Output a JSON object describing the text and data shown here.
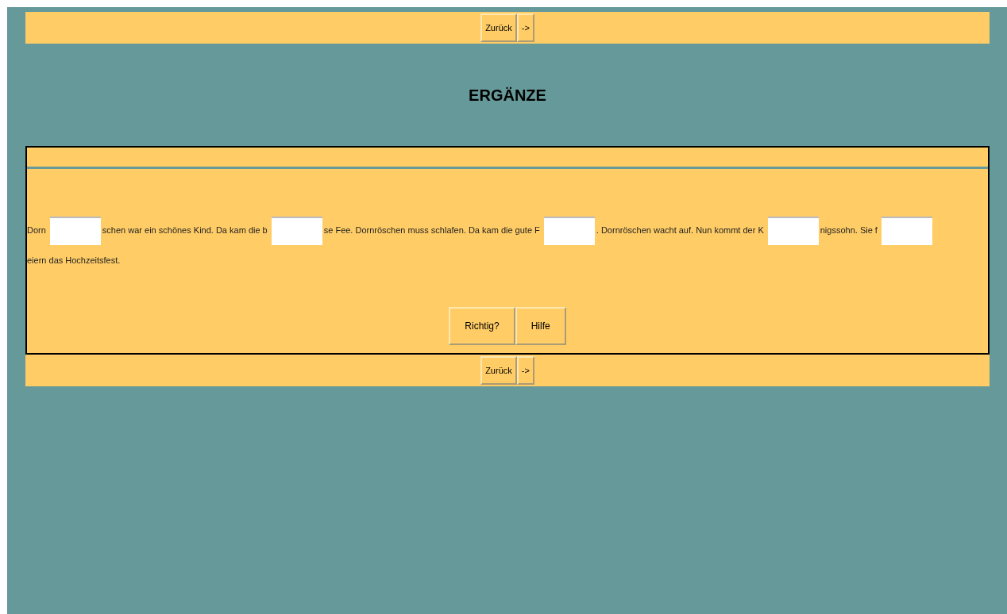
{
  "top_nav": {
    "buttons": [
      "Zurück",
      "->"
    ]
  },
  "title": "ERGÄNZE",
  "exercise": {
    "segments": [
      {
        "kind": "text",
        "text": "Dorn"
      },
      {
        "kind": "field"
      },
      {
        "kind": "text",
        "text": "schen war ein schönes Kind. Da kam die b"
      },
      {
        "kind": "field"
      },
      {
        "kind": "text",
        "text": "se Fee. Dornröschen muss schlafen. Da kam die gute F"
      },
      {
        "kind": "field"
      },
      {
        "kind": "text",
        "text": ". Dornröschen wacht auf. Nun kommt der K"
      },
      {
        "kind": "field"
      },
      {
        "kind": "text",
        "text": "nigssohn. Sie f"
      },
      {
        "kind": "field"
      },
      {
        "kind": "text",
        "text": "eiern das"
      },
      {
        "kind": "text",
        "text": "Hochzeitsfest."
      }
    ],
    "buttons": [
      "Richtig?",
      "Hilfe"
    ]
  },
  "bottom_nav": {
    "buttons": [
      "Zurück",
      "->"
    ]
  }
}
